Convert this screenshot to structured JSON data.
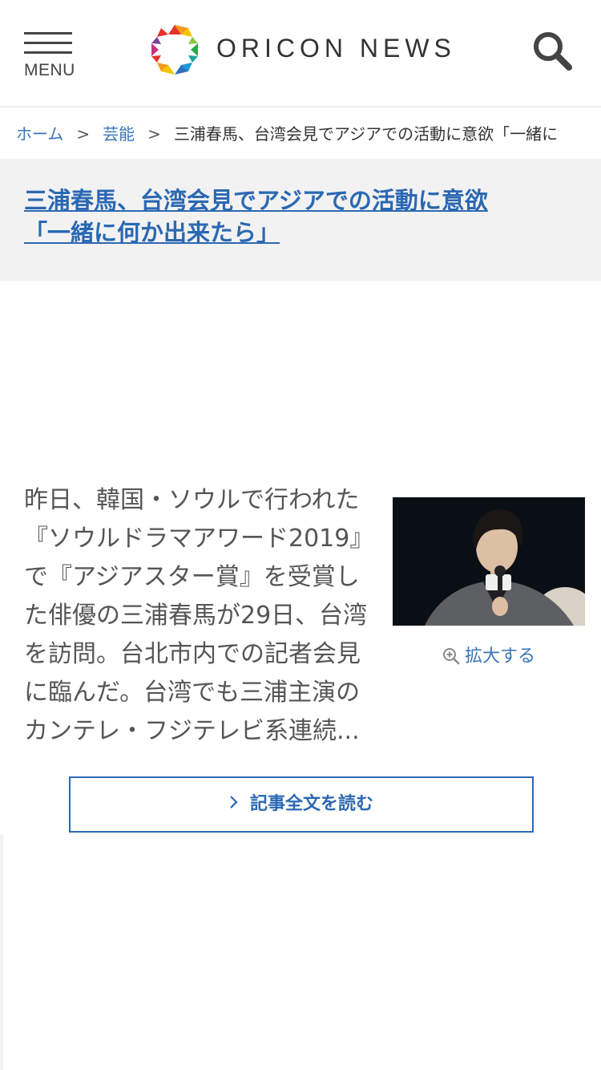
{
  "header": {
    "menu_label": "MENU",
    "logo_text": "ORICON NEWS"
  },
  "breadcrumb": {
    "home": "ホーム",
    "separator": ">",
    "category": "芸能",
    "current": "三浦春馬、台湾会見でアジアでの活動に意欲「一緒に"
  },
  "article": {
    "title_line1": "三浦春馬、台湾会見でアジアでの活動に意欲",
    "title_line2": "「一緒に何か出来たら」",
    "body": "昨日、韓国・ソウルで行われた『ソウルドラマアワード2019』で『アジアスター賞』を受賞した俳優の三浦春馬が29日、台湾を訪問。台北市内での記者会見に臨んだ。台湾でも三浦主演のカンテレ・フジテレビ系連続...",
    "zoom_label": "拡大する",
    "read_more_label": "記事全文を読む"
  },
  "icons": {
    "menu": "hamburger-menu-icon",
    "logo": "oricon-logo-icon",
    "search": "search-icon",
    "zoom": "zoom-in-icon",
    "chevron": "chevron-right-icon"
  },
  "colors": {
    "link": "#3a73b8",
    "headline": "#2b68b2",
    "title_band_bg": "#f2f2f2"
  }
}
